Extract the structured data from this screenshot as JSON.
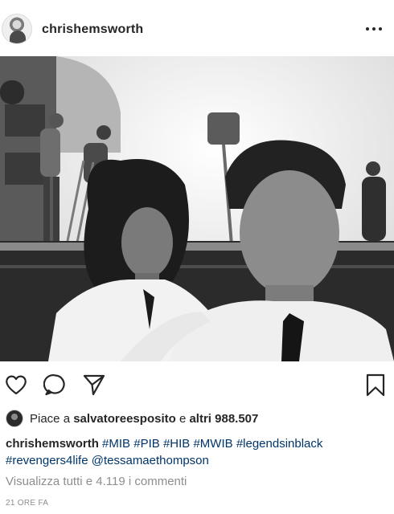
{
  "header": {
    "username": "chrishemsworth",
    "avatar_icon": "profile-avatar",
    "more_icon": "more-options-icon"
  },
  "photo": {
    "description_icon": "post-photo"
  },
  "actions": {
    "like_icon": "heart-icon",
    "comment_icon": "comment-icon",
    "share_icon": "send-icon",
    "save_icon": "bookmark-icon"
  },
  "likes": {
    "prefix": "Piace a",
    "user": "salvatoreesposito",
    "middle": "e",
    "others": "altri 988.507"
  },
  "caption": {
    "user": "chrishemsworth",
    "tags": [
      "#MIB",
      "#PIB",
      "#HIB",
      "#MWIB",
      "#legendsinblack",
      "#revengers4life",
      "@tessamaethompson"
    ]
  },
  "comments_link": "Visualizza tutti e 4.119 i commenti",
  "timestamp": "21 ORE FA",
  "colors": {
    "text": "#262626",
    "link": "#003569",
    "muted": "#8e8e8e"
  }
}
